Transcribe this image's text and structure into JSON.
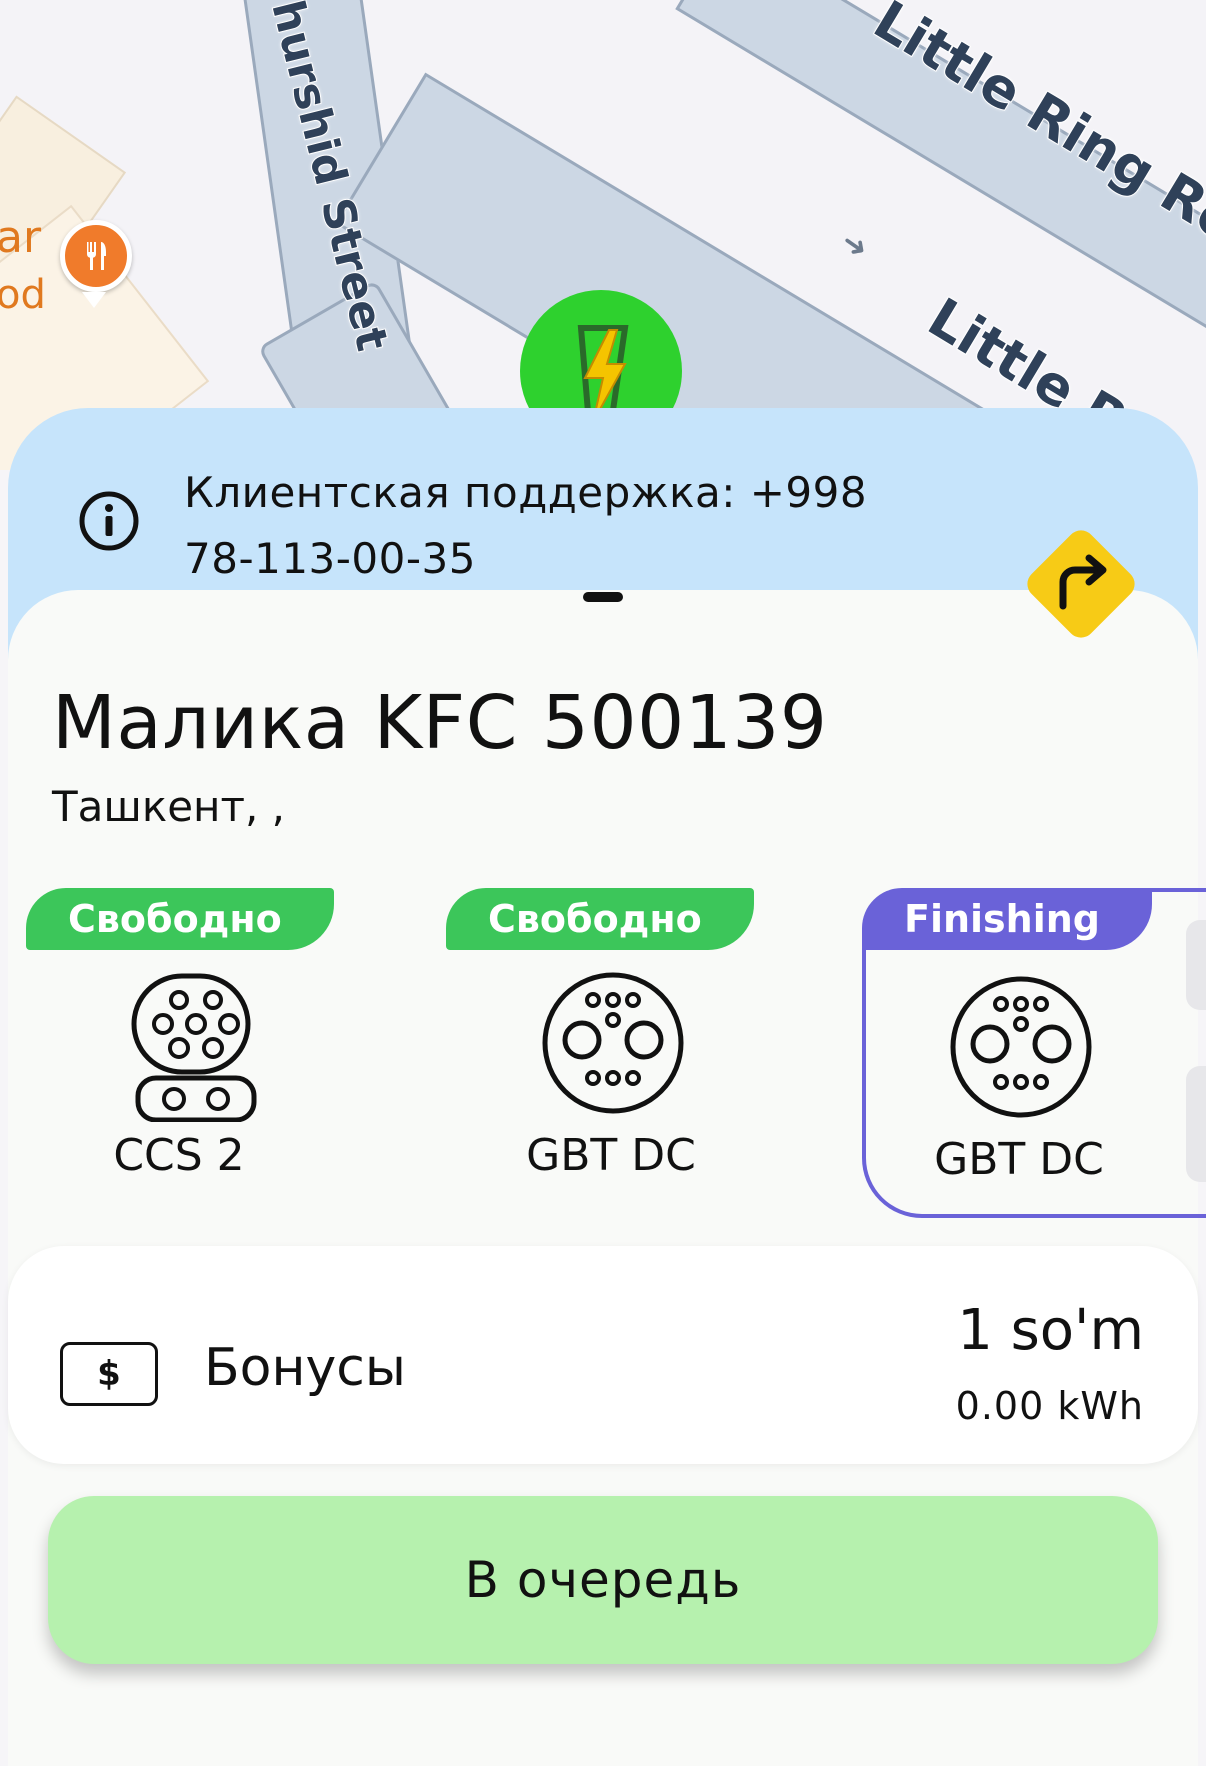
{
  "map": {
    "street_1": "hurshid Street",
    "street_2": "Little Ring Ro",
    "street_3": "Little R",
    "place_fragment_1": "ar",
    "place_fragment_2": "od",
    "poi_icon": "restaurant-icon",
    "marker_icon": "ev-charging-station-icon",
    "colors": {
      "road_fill": "#ccd7e4",
      "road_border": "#9aa9bc",
      "poi": "#f07b2b",
      "station_marker": "#2ed12e"
    }
  },
  "support": {
    "text": "Клиентская поддержка: +998 78-113-00-35",
    "icon": "info-icon"
  },
  "navigate": {
    "icon": "turn-right-arrow-icon",
    "color": "#f7cb16"
  },
  "station": {
    "name": "Малика KFC 500139",
    "address": "Ташкент, ,"
  },
  "connectors": [
    {
      "status": "Свободно",
      "type": "CCS 2",
      "status_color": "#3cc65a"
    },
    {
      "status": "Свободно",
      "type": "GBT DC",
      "status_color": "#3cc65a"
    },
    {
      "status": "Finishing",
      "type": "GBT DC",
      "status_color": "#6a62d8"
    }
  ],
  "bonus": {
    "icon": "dollar-bill-icon",
    "icon_symbol": "$",
    "label": "Бонусы",
    "amount": "1 so'm",
    "energy": "0.00 kWh"
  },
  "actions": {
    "queue_label": "В очередь",
    "queue_color": "#b6f1ae"
  }
}
